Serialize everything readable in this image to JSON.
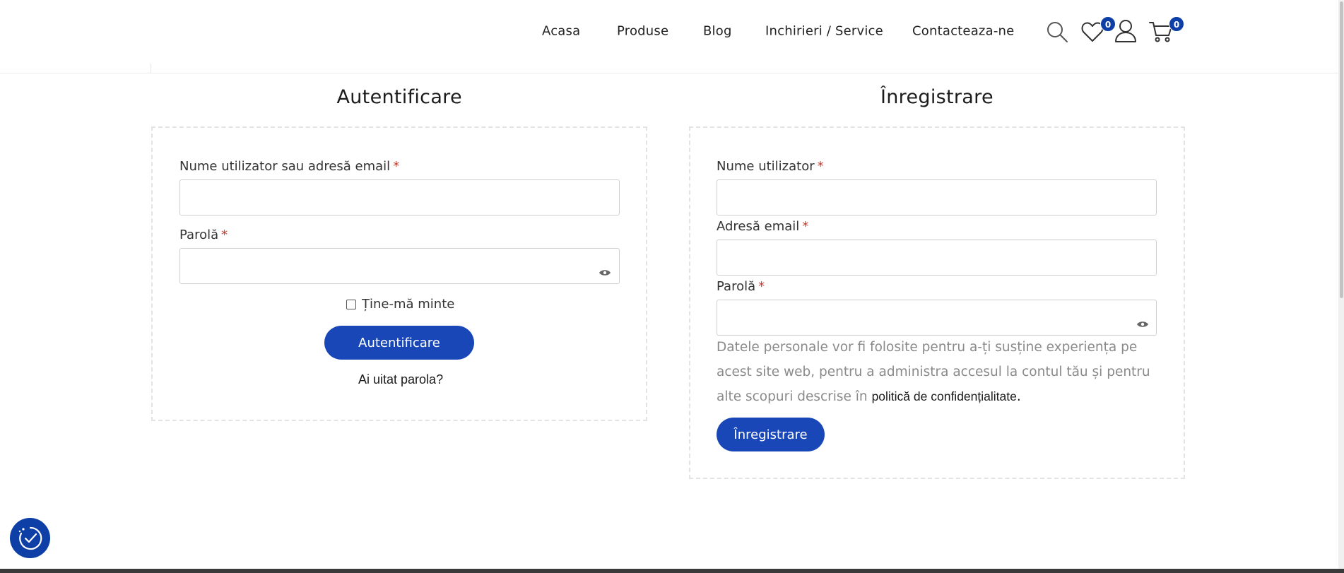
{
  "nav": {
    "items": [
      "Acasa",
      "Produse",
      "Blog",
      "Inchirieri / Service",
      "Contacteaza-ne"
    ]
  },
  "header_icons": {
    "search": "search-icon",
    "wishlist": "heart-icon",
    "account": "user-icon",
    "cart": "cart-icon",
    "wishlist_count": "0",
    "cart_count": "0"
  },
  "login": {
    "title": "Autentificare",
    "username_label": "Nume utilizator sau adresă email",
    "password_label": "Parolă",
    "required_mark": "*",
    "username_value": "",
    "password_value": "",
    "remember_label": "Ține-mă minte",
    "remember_checked": false,
    "submit_label": "Autentificare",
    "forgot_label": "Ai uitat parola?"
  },
  "register": {
    "title": "Înregistrare",
    "username_label": "Nume utilizator",
    "email_label": "Adresă email",
    "password_label": "Parolă",
    "required_mark": "*",
    "username_value": "",
    "email_value": "",
    "password_value": "",
    "privacy_text": "Datele personale vor fi folosite pentru a-ți susține experiența pe acest site web, pentru a administra accesul la contul tău și pentru alte scopuri descrise în",
    "privacy_link": "politică de confidențialitate",
    "privacy_end": ".",
    "submit_label": "Înregistrare"
  },
  "colors": {
    "primary": "#1a47b8",
    "badge": "#0d3fa6",
    "required": "#c0392b"
  },
  "accessibility": {
    "icon": "accessibility-icon"
  }
}
